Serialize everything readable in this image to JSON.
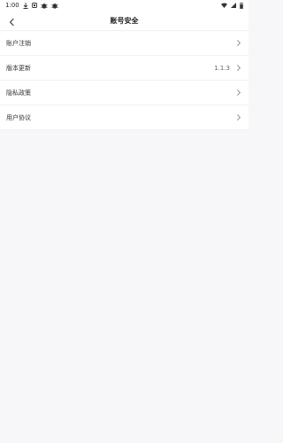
{
  "status_bar": {
    "time": "1:00",
    "icons": [
      "download-icon",
      "notification-square-icon",
      "bug-icon",
      "bug-icon"
    ],
    "right_icons": [
      "wifi-icon",
      "signal-icon",
      "battery-icon"
    ]
  },
  "header": {
    "title": "账号安全",
    "back_icon": "back-arrow-icon"
  },
  "list": {
    "items": [
      {
        "label": "账户注销",
        "value": ""
      },
      {
        "label": "版本更新",
        "value": "1.1.3"
      },
      {
        "label": "隐私政策",
        "value": ""
      },
      {
        "label": "用户协议",
        "value": ""
      }
    ]
  }
}
